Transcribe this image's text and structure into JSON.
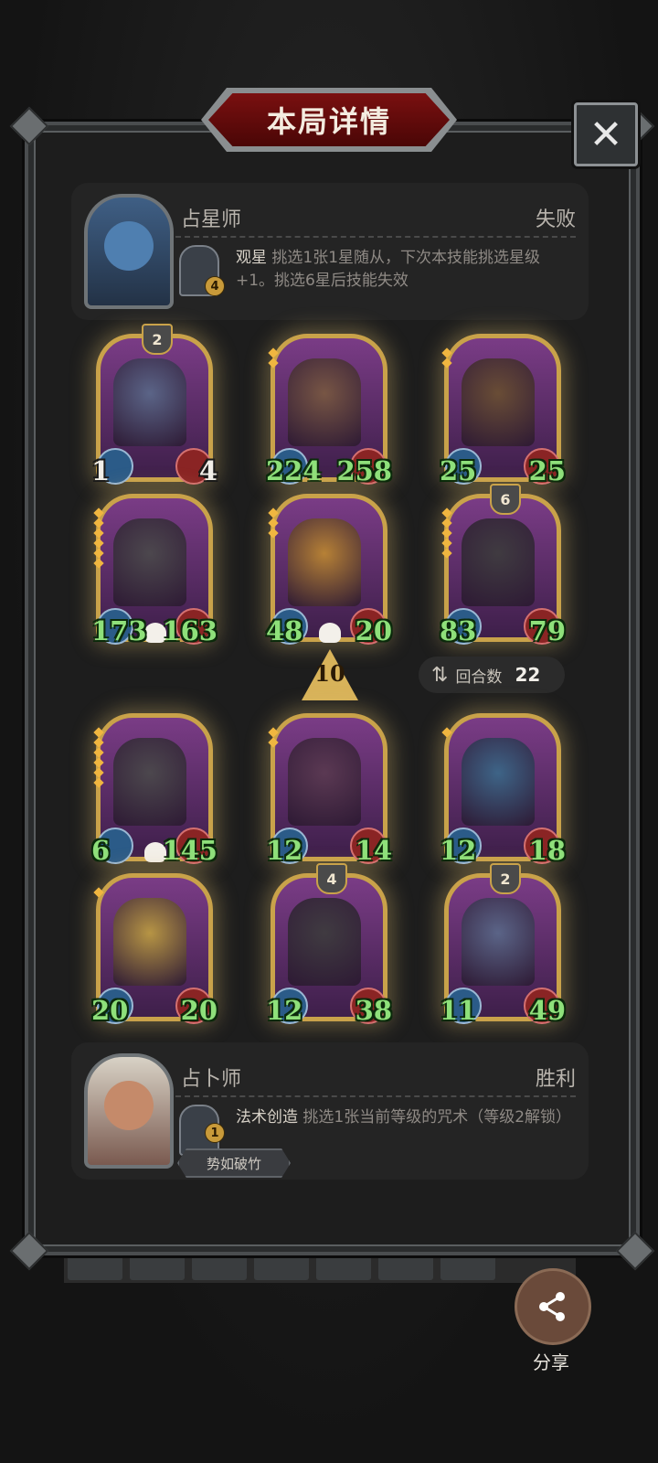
{
  "header": {
    "title": "本局详情",
    "close_icon": "close-icon"
  },
  "top_player": {
    "name": "占星师",
    "result": "失败",
    "skill_level": "4",
    "skill_name": "观星",
    "skill_desc": " 挑选1张1星随从，下次本技能挑选星级+1。挑选6星后技能失效"
  },
  "top_cards": [
    {
      "shield": "2",
      "atk": "1",
      "hp": "4",
      "stars": 0,
      "skull": false,
      "art_color": "#5a6a8a"
    },
    {
      "shield": "",
      "atk": "224",
      "hp": "258",
      "stars": 2,
      "skull": false,
      "art_color": "#7a5a40"
    },
    {
      "shield": "",
      "atk": "25",
      "hp": "25",
      "stars": 2,
      "skull": false,
      "art_color": "#6a5030"
    },
    {
      "shield": "",
      "atk": "173",
      "hp": "163",
      "stars": 6,
      "skull": true,
      "art_color": "#4a4a4a"
    },
    {
      "shield": "",
      "atk": "48",
      "hp": "20",
      "stars": 3,
      "skull": true,
      "art_color": "#c08a30"
    },
    {
      "shield": "6",
      "atk": "83",
      "hp": "79",
      "stars": 5,
      "skull": false,
      "art_color": "#3c3c3c"
    }
  ],
  "turn": {
    "level": "10",
    "label": "回合数",
    "value": "22"
  },
  "bottom_cards": [
    {
      "shield": "",
      "atk": "6",
      "hp": "145",
      "stars": 6,
      "skull": true,
      "art_color": "#4a4a4a"
    },
    {
      "shield": "",
      "atk": "12",
      "hp": "14",
      "stars": 2,
      "skull": false,
      "art_color": "#5a3a50"
    },
    {
      "shield": "",
      "atk": "12",
      "hp": "18",
      "stars": 1,
      "skull": false,
      "art_color": "#3a6a8a"
    },
    {
      "shield": "",
      "atk": "20",
      "hp": "20",
      "stars": 1,
      "skull": false,
      "art_color": "#c0a040"
    },
    {
      "shield": "4",
      "atk": "12",
      "hp": "38",
      "stars": 0,
      "skull": false,
      "art_color": "#3c3c3c"
    },
    {
      "shield": "2",
      "atk": "11",
      "hp": "49",
      "stars": 0,
      "skull": false,
      "art_color": "#5a6a8a"
    }
  ],
  "bottom_player": {
    "name": "占卜师",
    "result": "胜利",
    "skill_level": "1",
    "skill_name": "法术创造",
    "skill_desc": " 挑选1张当前等级的咒术（等级2解锁）",
    "tag": "势如破竹"
  },
  "share": {
    "label": "分享",
    "icon": "share-icon"
  }
}
